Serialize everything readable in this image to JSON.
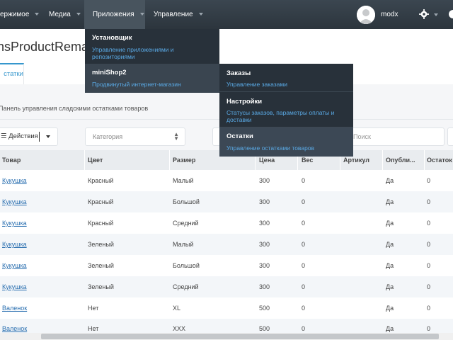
{
  "topnav": {
    "items": [
      {
        "label": "ержимое"
      },
      {
        "label": "Медиа"
      },
      {
        "label": "Приложения"
      },
      {
        "label": "Управление"
      }
    ],
    "username": "modx"
  },
  "page": {
    "title": "nsProductRema",
    "tab": "статки",
    "description": "Панель управления сладскими остатками товаров"
  },
  "toolbar": {
    "actions_label": "Действия",
    "category_placeholder": "Категория",
    "search_placeholder": "Поиск"
  },
  "grid": {
    "columns": [
      "Товар",
      "Цвет",
      "Размер",
      "Цена",
      "Вес",
      "Артикул",
      "Опубли...",
      "Остаток"
    ],
    "rows": [
      [
        "Кукушка",
        "Красный",
        "Малый",
        "300",
        "0",
        "",
        "Да",
        "0"
      ],
      [
        "Кукушка",
        "Красный",
        "Большой",
        "300",
        "0",
        "",
        "Да",
        "0"
      ],
      [
        "Кукушка",
        "Красный",
        "Средний",
        "300",
        "0",
        "",
        "Да",
        "0"
      ],
      [
        "Кукушка",
        "Зеленый",
        "Малый",
        "300",
        "0",
        "",
        "Да",
        "0"
      ],
      [
        "Кукушка",
        "Зеленый",
        "Большой",
        "300",
        "0",
        "",
        "Да",
        "0"
      ],
      [
        "Кукушка",
        "Зеленый",
        "Средний",
        "300",
        "0",
        "",
        "Да",
        "0"
      ],
      [
        "Валенок",
        "Нет",
        "XL",
        "500",
        "0",
        "",
        "Да",
        "0"
      ],
      [
        "Валенок",
        "Нет",
        "XXX",
        "500",
        "0",
        "",
        "Да",
        "0"
      ]
    ]
  },
  "menu": {
    "items": [
      {
        "title": "Установщик",
        "subtitle": "Управление приложениями и репозиториями"
      },
      {
        "title": "miniShop2",
        "subtitle": "Продвинутый интернет-магазин"
      }
    ]
  },
  "submenu": {
    "items": [
      {
        "title": "Заказы",
        "subtitle": "Управление заказами"
      },
      {
        "title": "Настройки",
        "subtitle": "Статусы заказов, параметры оплаты и доставки"
      },
      {
        "title": "Остатки",
        "subtitle": "Управление остатками товаров"
      }
    ]
  }
}
